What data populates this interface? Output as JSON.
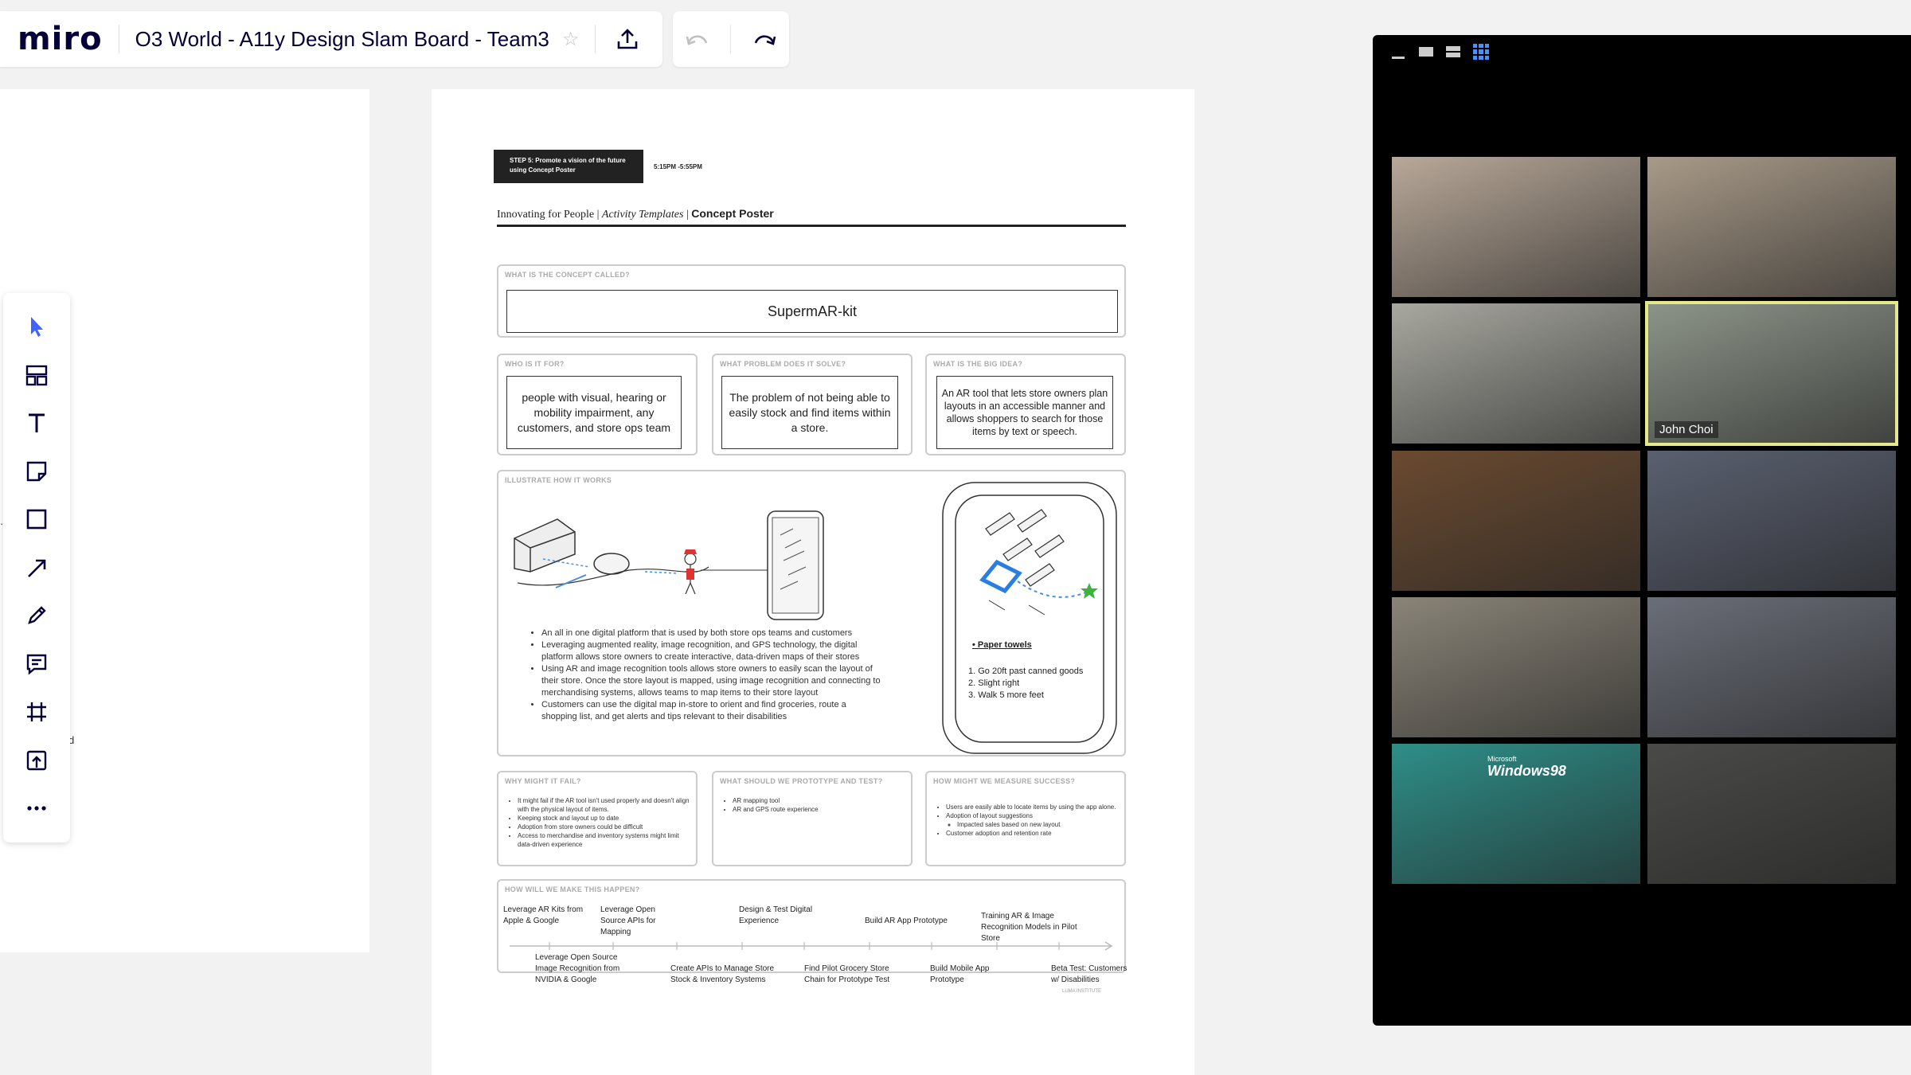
{
  "app": {
    "logo": "miro",
    "board_title": "O3 World - A11y Design Slam Board - Team3"
  },
  "poster": {
    "step_badge": "STEP 5: Promote a vision of the future using Concept Poster",
    "step_time": "5:15PM -5:55PM",
    "header_part1": "Innovating for People",
    "header_part2": "Activity Templates",
    "header_part3": "Concept Poster",
    "concept_label": "WHAT IS THE CONCEPT CALLED?",
    "concept_name": "SupermAR-kit",
    "who_label": "WHO IS IT FOR?",
    "who_text": "people with visual, hearing or mobility  impairment, any customers, and store ops team",
    "problem_label": "WHAT PROBLEM DOES IT SOLVE?",
    "problem_text": "The problem of not being able to easily stock and find items within a store.",
    "idea_label": "WHAT IS THE BIG IDEA?",
    "idea_text": "An AR tool that lets store owners plan layouts in an accessible manner and allows shoppers to search for those items by text or speech.",
    "illustrate_label": "ILLUSTRATE HOW IT WORKS",
    "how_bullets": [
      "An all in one digital platform that is used by both store ops teams and customers",
      "Leveraging augmented reality, image recognition, and GPS technology, the digital platform allows store owners to create interactive, data-driven maps of their stores",
      "Using AR and image recognition tools allows store owners to easily scan the layout of their store. Once the store layout is mapped, using image recognition and connecting to merchandising systems, allows teams to map items to their store layout",
      "Customers can use the digital map in-store to orient and find groceries, route a shopping list, and get alerts and tips relevant to their disabilities"
    ],
    "phone_item": "• Paper towels",
    "phone_steps": [
      "1. Go 20ft past canned goods",
      "2. Slight right",
      "3. Walk 5 more feet"
    ],
    "fail_label": "WHY MIGHT IT FAIL?",
    "fail_bullets": [
      "It might fail if the AR tool isn't used properly and doesn't align with the physical layout of items.",
      "Keeping stock and layout up to date",
      "Adoption from store owners could be difficult",
      "Access to merchandise and inventory systems might limit data-driven experience"
    ],
    "prototype_label": "WHAT SHOULD WE PROTOTYPE AND TEST?",
    "prototype_bullets": [
      "AR mapping tool",
      "AR and GPS route experience"
    ],
    "measure_label": "HOW MIGHT WE MEASURE SUCCESS?",
    "measure_bullets": [
      "Users are easily able to locate items by using the app alone.",
      "Adoption of layout suggestions",
      "Customer adoption and retention rate"
    ],
    "measure_sub": "Impacted sales based on new layout",
    "happen_label": "HOW WILL WE MAKE THIS HAPPEN?",
    "timeline_top": [
      "Leverage AR Kits from Apple & Google",
      "Leverage Open Source APIs for Mapping",
      "Design & Test Digital Experience",
      "Build AR App Prototype",
      "Training AR & Image Recognition Models in Pilot Store"
    ],
    "timeline_bottom": [
      "Leverage Open Source Image Recognition from NVIDIA & Google",
      "Create APIs to Manage Store Stock & Inventory Systems",
      "Find Pilot Grocery Store Chain for Prototype Test",
      "Build Mobile App Prototype",
      "Beta Test: Customers w/ Disabilities"
    ],
    "footer_logo": "LUMA INSTITUTE"
  },
  "zoom": {
    "active_speaker": "John Choi",
    "tile_colors": [
      "#b8a898",
      "#a89a88",
      "#a8a8a0",
      "#8c9488",
      "#6a4a30",
      "#5a6070",
      "#8a8478",
      "#6a6e78",
      "#2e8e88",
      "#4a4a48"
    ],
    "win98_brand": "Microsoft",
    "win98_text": "Windows98"
  }
}
